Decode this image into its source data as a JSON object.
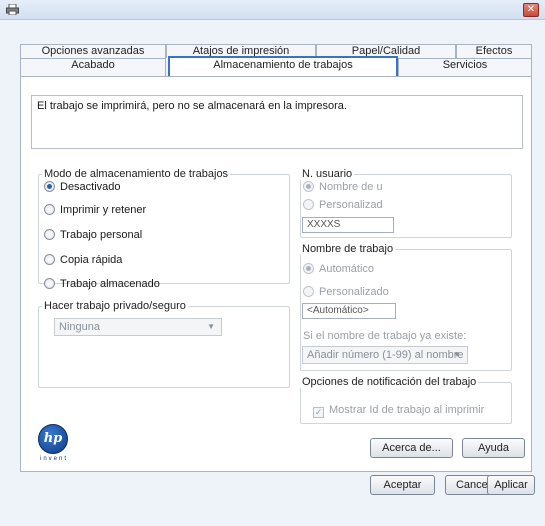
{
  "tabs": {
    "row_back": [
      "Opciones avanzadas",
      "Atajos de impresión",
      "Papel/Calidad",
      "Efectos"
    ],
    "row_front": [
      "Acabado",
      "Almacenamiento de trabajos",
      "Servicios"
    ]
  },
  "message": "El trabajo se imprimirá, pero no se almacenará en la impresora.",
  "storage_mode": {
    "title": "Modo de almacenamiento de trabajos",
    "options": [
      "Desactivado",
      "Imprimir y retener",
      "Trabajo personal",
      "Copia rápida",
      "Trabajo almacenado"
    ]
  },
  "private": {
    "title": "Hacer trabajo privado/seguro",
    "value": "Ninguna"
  },
  "user": {
    "title": "N. usuario",
    "options": [
      "Nombre de u",
      "Personalizad"
    ],
    "value": "XXXXS"
  },
  "job_name": {
    "title": "Nombre de trabajo",
    "options": [
      "Automático",
      "Personalizado"
    ],
    "value": "<Automático>",
    "if_exists_label": "Si el nombre de trabajo ya existe:",
    "if_exists_value": "Añadir número (1-99) al nombre"
  },
  "notify": {
    "title": "Opciones de notificación del trabajo",
    "checkbox": "Mostrar Id de trabajo al imprimir"
  },
  "buttons": {
    "about": "Acerca de...",
    "help": "Ayuda",
    "ok": "Aceptar",
    "cancel": "Cancelar",
    "apply": "Aplicar"
  },
  "logo": {
    "mark": "hp",
    "tagline": "invent"
  }
}
